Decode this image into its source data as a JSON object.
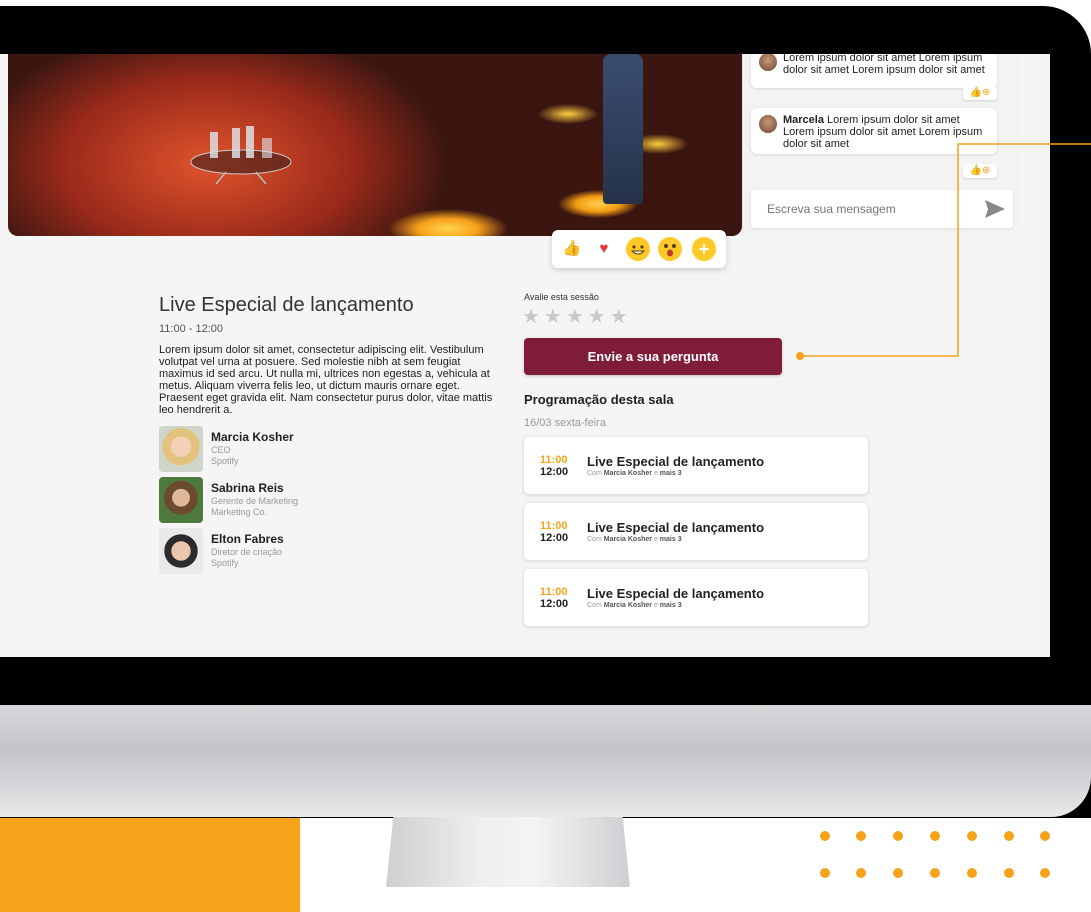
{
  "chat": {
    "messages": [
      {
        "name": "",
        "text": "Lorem ipsum dolor sit amet Lorem ipsum dolor sit amet Lorem ipsum dolor sit amet"
      },
      {
        "name": "Marcela",
        "text": "Lorem ipsum dolor sit amet Lorem ipsum dolor sit amet Lorem ipsum dolor sit amet"
      }
    ],
    "input_placeholder": "Escreva sua mensagem"
  },
  "reactions": [
    "thumbs-up",
    "heart",
    "grin",
    "surprised",
    "add"
  ],
  "session": {
    "title": "Live Especial de lançamento",
    "time": "11:00 - 12:00",
    "description": "Lorem ipsum dolor sit amet, consectetur adipiscing elit. Vestibulum volutpat vel urna at posuere. Sed molestie nibh at sem feugiat maximus id sed arcu. Ut nulla mi, ultrices non egestas a, vehicula at metus. Aliquam viverra felis leo, ut dictum mauris ornare eget. Praesent eget gravida elit. Nam consectetur purus dolor, vitae mattis leo hendrerit a."
  },
  "speakers": [
    {
      "name": "Marcia Kosher",
      "role": "CEO",
      "company": "Spotify"
    },
    {
      "name": "Sabrina Reis",
      "role": "Gerente de Marketing",
      "company": "Marketing Co."
    },
    {
      "name": "Elton Fabres",
      "role": "Diretor de criação",
      "company": "Spotify"
    }
  ],
  "rating": {
    "label": "Avalie esta sessão",
    "stars": "★★★★★",
    "value": 0,
    "max": 5
  },
  "ask_button": "Envie a sua pergunta",
  "schedule": {
    "title": "Programação desta sala",
    "date": "16/03 sexta-feira",
    "items": [
      {
        "start": "11:00",
        "end": "12:00",
        "title": "Live Especial de lançamento",
        "with_prefix": "Com",
        "with_name": "Marcia Kosher",
        "with_sep": "e",
        "with_more": "mais 3"
      },
      {
        "start": "11:00",
        "end": "12:00",
        "title": "Live Especial de lançamento",
        "with_prefix": "Com",
        "with_name": "Marcia Kosher",
        "with_sep": "e",
        "with_more": "mais 3"
      },
      {
        "start": "11:00",
        "end": "12:00",
        "title": "Live Especial de lançamento",
        "with_prefix": "Com",
        "with_name": "Marcia Kosher",
        "with_sep": "e",
        "with_more": "mais 3"
      }
    ]
  },
  "colors": {
    "accent": "#f7a21b",
    "brand": "#7f1d39",
    "screen_bg": "#f5f5f5"
  }
}
